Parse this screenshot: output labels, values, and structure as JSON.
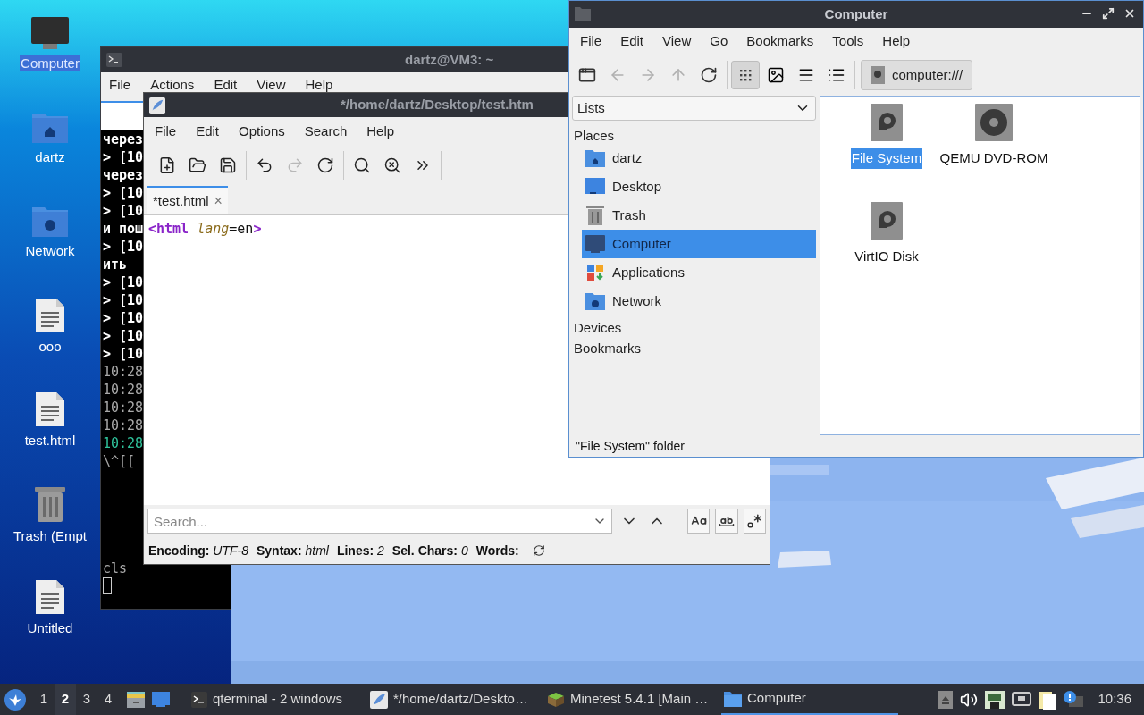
{
  "desktop_icons": [
    {
      "label": "Computer",
      "kind": "computer",
      "selected": true
    },
    {
      "label": "dartz",
      "kind": "home",
      "selected": false
    },
    {
      "label": "Network",
      "kind": "network",
      "selected": false
    },
    {
      "label": "ooo",
      "kind": "file",
      "selected": false
    },
    {
      "label": "test.html",
      "kind": "file",
      "selected": false
    },
    {
      "label": "Trash (Empt",
      "kind": "trash",
      "selected": false
    },
    {
      "label": "Untitled",
      "kind": "file",
      "selected": false
    }
  ],
  "terminal": {
    "title": "dartz@VM3: ~",
    "menu": [
      "File",
      "Actions",
      "Edit",
      "View",
      "Help"
    ],
    "lines": [
      {
        "text": "через",
        "kind": "bold"
      },
      {
        "text": "> [10",
        "kind": "bold"
      },
      {
        "text": "через",
        "kind": "bold"
      },
      {
        "text": "> [10",
        "kind": "bold"
      },
      {
        "text": "> [10",
        "kind": "bold"
      },
      {
        "text": "и пош",
        "kind": "bold"
      },
      {
        "text": "> [10",
        "kind": "bold"
      },
      {
        "text": "ить",
        "kind": "bold"
      },
      {
        "text": "> [10",
        "kind": "bold"
      },
      {
        "text": "> [10",
        "kind": "bold"
      },
      {
        "text": "> [10",
        "kind": "bold"
      },
      {
        "text": "> [10",
        "kind": "bold"
      },
      {
        "text": "> [10",
        "kind": "bold"
      },
      {
        "text": "10:28",
        "kind": "dim"
      },
      {
        "text": "10:28",
        "kind": "dim"
      },
      {
        "text": "10:28",
        "kind": "dim"
      },
      {
        "text": "10:28",
        "kind": "dim"
      },
      {
        "text": "10:28",
        "kind": "green"
      },
      {
        "text": "\\^[[",
        "kind": "dim"
      }
    ],
    "command": "cls"
  },
  "editor": {
    "title": "*/home/dartz/Desktop/test.htm",
    "menu": [
      "File",
      "Edit",
      "Options",
      "Search",
      "Help"
    ],
    "toolbar": [
      [
        {
          "kind": "new",
          "disabled": false
        },
        {
          "kind": "open",
          "disabled": false
        },
        {
          "kind": "save",
          "disabled": false
        }
      ],
      [
        {
          "kind": "undo",
          "disabled": false
        },
        {
          "kind": "redo",
          "disabled": true
        },
        {
          "kind": "reload",
          "disabled": false
        }
      ],
      [
        {
          "kind": "find",
          "disabled": false
        },
        {
          "kind": "replace",
          "disabled": false
        },
        {
          "kind": "more",
          "disabled": false
        }
      ]
    ],
    "tab": {
      "label": "*test.html",
      "close": "×"
    },
    "code": [
      {
        "text": "<html",
        "kind": "tag"
      },
      {
        "text": " lang",
        "kind": "attr"
      },
      {
        "text": "=en",
        "kind": "plain"
      },
      {
        "text": ">",
        "kind": "tag"
      }
    ],
    "search": {
      "placeholder": "Search..."
    },
    "status": [
      {
        "label": "Encoding:",
        "value": "UTF-8"
      },
      {
        "label": "Syntax:",
        "value": "html"
      },
      {
        "label": "Lines:",
        "value": "2"
      },
      {
        "label": "Sel. Chars:",
        "value": "0"
      },
      {
        "label": "Words:"
      }
    ]
  },
  "file_manager": {
    "title": "Computer",
    "menu": [
      "File",
      "Edit",
      "View",
      "Go",
      "Bookmarks",
      "Tools",
      "Help"
    ],
    "nav_buttons": [
      {
        "kind": "new-tab",
        "disabled": false
      },
      {
        "kind": "back",
        "disabled": true
      },
      {
        "kind": "forward",
        "disabled": true
      },
      {
        "kind": "up",
        "disabled": true
      },
      {
        "kind": "reload",
        "disabled": false
      }
    ],
    "view_buttons": [
      {
        "kind": "icons",
        "selected": true
      },
      {
        "kind": "thumbnails",
        "selected": false
      },
      {
        "kind": "compact",
        "selected": false
      },
      {
        "kind": "detailed",
        "selected": false
      }
    ],
    "path": "computer:///",
    "side_mode": "Lists",
    "places_header": "Places",
    "places": [
      {
        "label": "dartz",
        "kind": "home",
        "selected": false
      },
      {
        "label": "Desktop",
        "kind": "desktop",
        "selected": false
      },
      {
        "label": "Trash",
        "kind": "trash",
        "selected": false
      },
      {
        "label": "Computer",
        "kind": "computer",
        "selected": true
      },
      {
        "label": "Applications",
        "kind": "apps",
        "selected": false
      },
      {
        "label": "Network",
        "kind": "network",
        "selected": false
      }
    ],
    "sections": [
      "Devices",
      "Bookmarks"
    ],
    "items": [
      {
        "label": "File System",
        "kind": "drive",
        "selected": true
      },
      {
        "label": "QEMU DVD-ROM",
        "kind": "disc",
        "selected": false
      },
      {
        "label": "VirtIO Disk",
        "kind": "drive",
        "selected": false
      }
    ],
    "status": "\"File System\" folder"
  },
  "taskbar": {
    "workspaces": [
      {
        "label": "1",
        "selected": false
      },
      {
        "label": "2",
        "selected": true
      },
      {
        "label": "3",
        "selected": false
      },
      {
        "label": "4",
        "selected": false
      }
    ],
    "tasks": [
      {
        "label": "qterminal - 2 windows",
        "kind": "terminal",
        "selected": false
      },
      {
        "label": "*/home/dartz/Deskto…",
        "kind": "editor",
        "selected": false
      },
      {
        "label": "Minetest 5.4.1 [Main …",
        "kind": "game",
        "selected": false
      },
      {
        "label": "Computer",
        "kind": "folder",
        "selected": true
      }
    ],
    "clock": "10:36"
  }
}
